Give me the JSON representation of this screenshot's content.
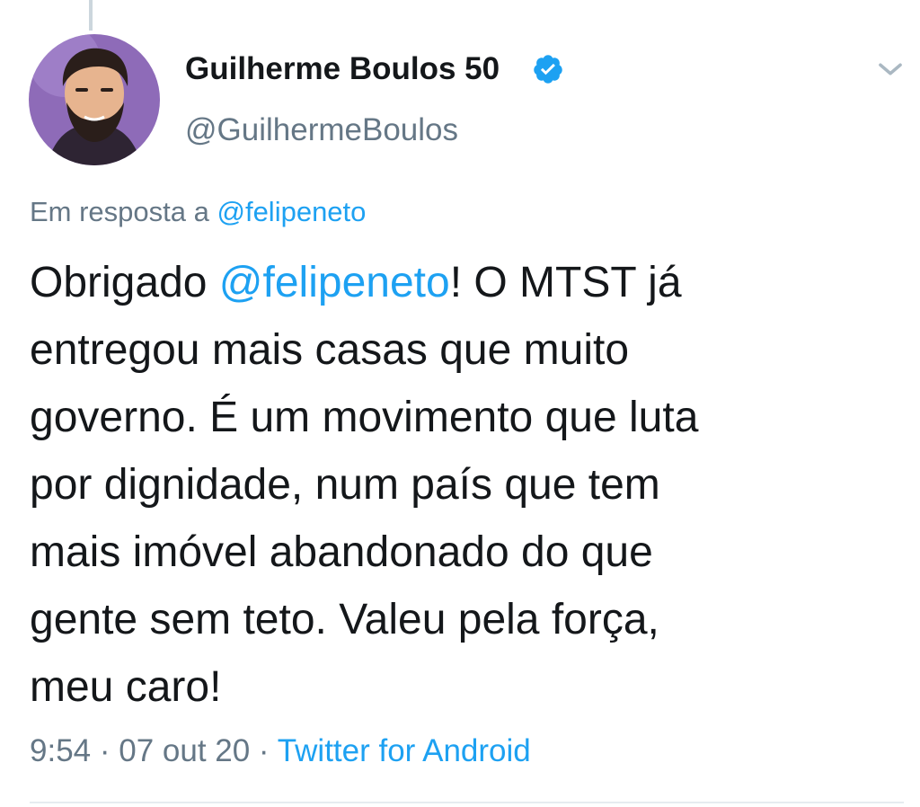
{
  "author": {
    "name": "Guilherme Boulos 50",
    "handle": "@GuilhermeBoulos",
    "verified": true
  },
  "reply": {
    "prefix": "Em resposta a ",
    "mention": "@felipeneto"
  },
  "tweet": {
    "lines": [
      {
        "before": "Obrigado ",
        "mention": "@felipeneto",
        "after": "! O MTST já"
      },
      {
        "text": "entregou mais casas que muito"
      },
      {
        "text": "governo. É um movimento que luta"
      },
      {
        "text": "por dignidade, num país que tem"
      },
      {
        "text": "mais imóvel abandonado do que"
      },
      {
        "text": "gente sem teto. Valeu pela força,"
      },
      {
        "text": "meu caro!"
      }
    ]
  },
  "meta": {
    "time": "9:54",
    "date": "07 out 20",
    "separator": " · ",
    "source": "Twitter for Android"
  },
  "icons": {
    "verified": "verified-badge-icon",
    "menu": "chevron-down-icon"
  },
  "colors": {
    "link": "#1da1f2",
    "secondary_text": "#657786",
    "primary_text": "#14171a",
    "avatar_bg": "#8e6bb8"
  }
}
